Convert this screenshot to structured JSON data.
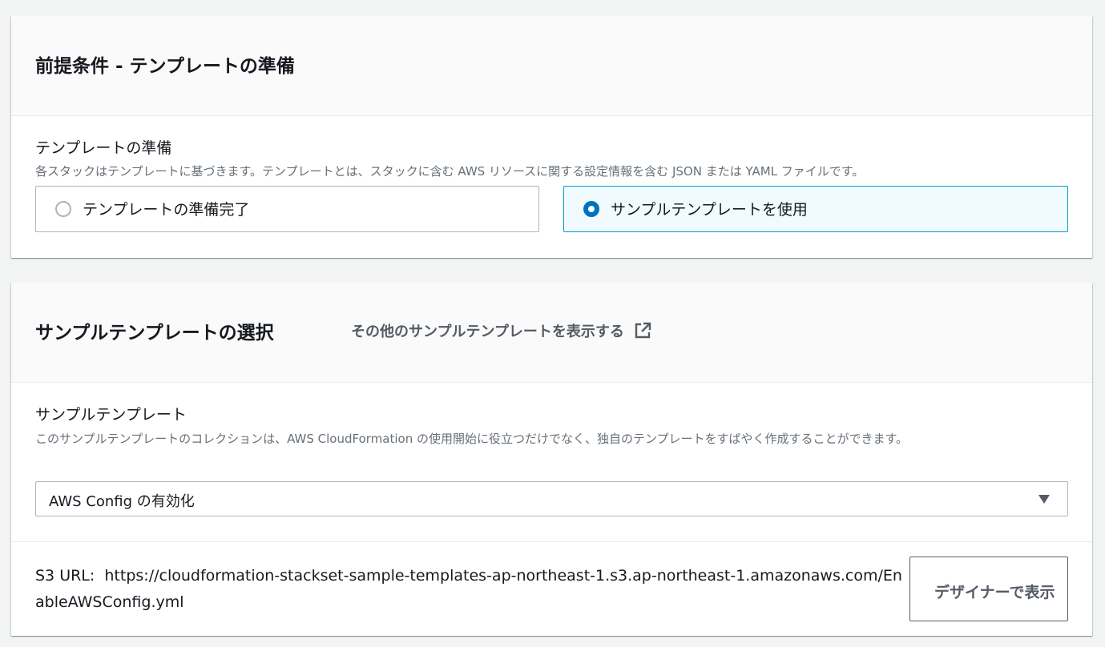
{
  "prerequisite": {
    "title": "前提条件 - テンプレートの準備",
    "field_label": "テンプレートの準備",
    "field_description": "各スタックはテンプレートに基づきます。テンプレートとは、スタックに含む AWS リソースに関する設定情報を含む JSON または YAML ファイルです。",
    "options": [
      {
        "label": "テンプレートの準備完了",
        "selected": false
      },
      {
        "label": "サンプルテンプレートを使用",
        "selected": true
      }
    ]
  },
  "sample_selection": {
    "title": "サンプルテンプレートの選択",
    "more_link": "その他のサンプルテンプレートを表示する",
    "more_link_icon": "external-link-icon",
    "field_label": "サンプルテンプレート",
    "field_description": "このサンプルテンプレートのコレクションは、AWS CloudFormation の使用開始に役立つだけでなく、独自のテンプレートをすばやく作成することができます。",
    "selected_template": "AWS Config の有効化",
    "s3_label": "S3 URL:",
    "s3_url": "https://cloudformation-stackset-sample-templates-ap-northeast-1.s3.ap-northeast-1.amazonaws.com/EnableAWSConfig.yml",
    "designer_button": "デザイナーで表示"
  },
  "colors": {
    "accent": "#0073bb",
    "selected_border": "#00a1c9",
    "selected_bg": "#f1faff",
    "page_bg": "#f2f3f3"
  }
}
